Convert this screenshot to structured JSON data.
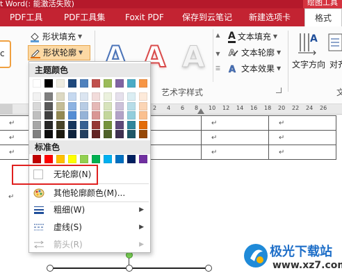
{
  "window": {
    "title": "t Word(: 能激活失败)",
    "contextual_tab_group": "绘图工具"
  },
  "tabs": [
    {
      "label": "PDF工具"
    },
    {
      "label": "PDF工具集"
    },
    {
      "label": "Foxit PDF"
    },
    {
      "label": "保存到云笔记"
    },
    {
      "label": "新建选项卡"
    },
    {
      "label": "格式"
    }
  ],
  "ribbon": {
    "style_box_fragment": "c",
    "shape_fill": "形状填充",
    "shape_outline": "形状轮廓",
    "wordart_letter": "A",
    "wordart_group_label": "艺术字样式",
    "text_fill": "文本填充",
    "text_outline": "文本轮廓",
    "text_effects": "文本效果",
    "text_direction": "文字方向",
    "align_text_fragment": "对齐",
    "cut_group_fragment": "文"
  },
  "ruler": {
    "numbers": [
      "2",
      "4",
      "6",
      "8",
      "10",
      "12",
      "14",
      "16",
      "18",
      "20",
      "22",
      "24",
      "26"
    ]
  },
  "document": {
    "para_mark": "↵",
    "table_rows": [
      [
        "↵",
        "↵",
        "↵",
        "↵",
        "↵"
      ],
      [
        "↵",
        "↵",
        "↵",
        "↵",
        "↵"
      ],
      [
        "↵",
        "↵",
        "↵",
        "↵",
        "↵"
      ]
    ]
  },
  "menu": {
    "theme_colors_header": "主题颜色",
    "standard_colors_header": "标准色",
    "theme_top_row": [
      "#ffffff",
      "#000000",
      "#eeece1",
      "#1f497d",
      "#4f81bd",
      "#c0504d",
      "#9bbb59",
      "#8064a2",
      "#4bacc6",
      "#f79646"
    ],
    "theme_shade_columns": [
      [
        "#f2f2f2",
        "#d9d9d9",
        "#bfbfbf",
        "#a6a6a6",
        "#808080"
      ],
      [
        "#7f7f7f",
        "#595959",
        "#404040",
        "#262626",
        "#0d0d0d"
      ],
      [
        "#ddd9c3",
        "#c4bd97",
        "#938953",
        "#494429",
        "#1d1b10"
      ],
      [
        "#c6d9f0",
        "#8db3e2",
        "#548dd4",
        "#17365d",
        "#0f243e"
      ],
      [
        "#dbe5f1",
        "#b8cce4",
        "#95b3d7",
        "#366092",
        "#244061"
      ],
      [
        "#f2dcdb",
        "#e5b9b7",
        "#d99694",
        "#953734",
        "#632423"
      ],
      [
        "#ebf1dd",
        "#d7e3bc",
        "#c3d69b",
        "#76923c",
        "#4f6128"
      ],
      [
        "#e5e0ec",
        "#ccc1d9",
        "#b2a2c7",
        "#5f497a",
        "#3f3151"
      ],
      [
        "#dbeef3",
        "#b7dde8",
        "#92cddc",
        "#31859b",
        "#205867"
      ],
      [
        "#fdeada",
        "#fbd5b5",
        "#fac08f",
        "#e36c09",
        "#974806"
      ]
    ],
    "standard_colors": [
      "#c00000",
      "#ff0000",
      "#ffc000",
      "#ffff00",
      "#92d050",
      "#00b050",
      "#00b0f0",
      "#0070c0",
      "#002060",
      "#7030a0"
    ],
    "items": {
      "no_outline": "无轮廓(N)",
      "more_colors": "其他轮廓颜色(M)...",
      "weight": "粗细(W)",
      "dashes": "虚线(S)",
      "arrows": "箭头(R)"
    },
    "accent_color": "#e0201f"
  },
  "watermark": {
    "logo_text": "极光下载站",
    "url": "www.xz7.com"
  }
}
